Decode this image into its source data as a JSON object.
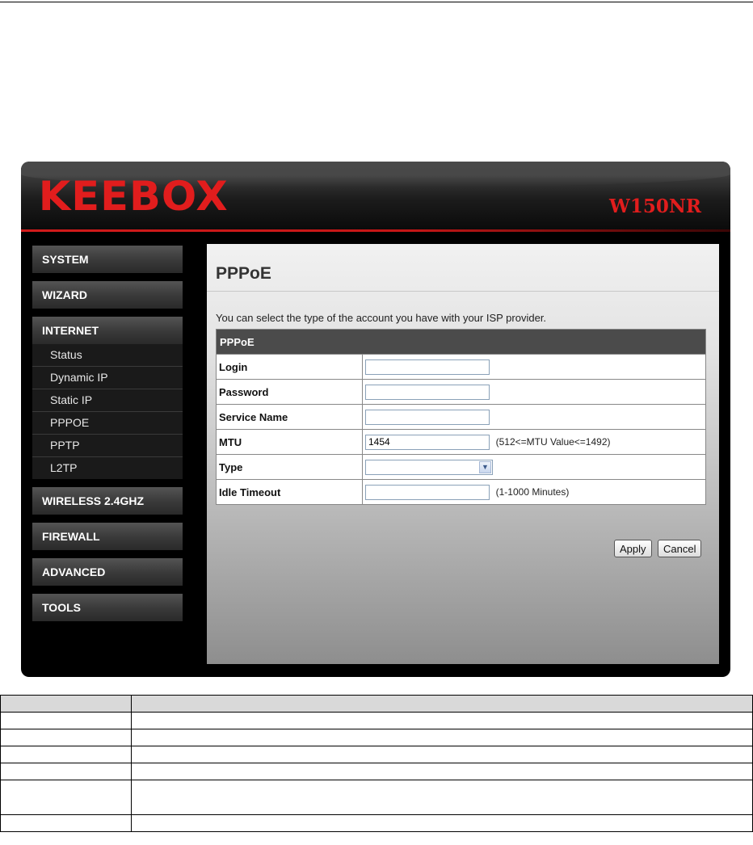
{
  "router": {
    "brand": "KEEBOX",
    "model": "W150NR",
    "accent_color": "#e11d1d"
  },
  "sidebar": {
    "groups": [
      {
        "label": "SYSTEM"
      },
      {
        "label": "WIZARD"
      },
      {
        "label": "INTERNET",
        "open": true,
        "items": [
          "Status",
          "Dynamic IP",
          "Static IP",
          "PPPOE",
          "PPTP",
          "L2TP"
        ]
      },
      {
        "label": "WIRELESS 2.4GHZ"
      },
      {
        "label": "FIREWALL"
      },
      {
        "label": "ADVANCED"
      },
      {
        "label": "TOOLS"
      }
    ]
  },
  "content": {
    "title": "PPPoE",
    "description": "You can select the type of the account you have with your ISP provider.",
    "form": {
      "header": "PPPoE",
      "fields": [
        {
          "label": "Login",
          "value": "",
          "kind": "text"
        },
        {
          "label": "Password",
          "value": "",
          "kind": "password"
        },
        {
          "label": "Service Name",
          "value": "",
          "kind": "text"
        },
        {
          "label": "MTU",
          "value": "1454",
          "kind": "text",
          "hint": "(512<=MTU Value<=1492)"
        },
        {
          "label": "Type",
          "value": "",
          "kind": "select"
        },
        {
          "label": "Idle Timeout",
          "value": "",
          "kind": "text",
          "hint": "(1-1000 Minutes)"
        }
      ]
    },
    "buttons": {
      "apply": "Apply",
      "cancel": "Cancel"
    }
  },
  "param_table": {
    "headers": [
      "",
      ""
    ],
    "rows": [
      [
        "",
        ""
      ],
      [
        "",
        ""
      ],
      [
        "",
        ""
      ],
      [
        "",
        ""
      ],
      [
        "",
        ""
      ],
      [
        "",
        ""
      ]
    ]
  }
}
